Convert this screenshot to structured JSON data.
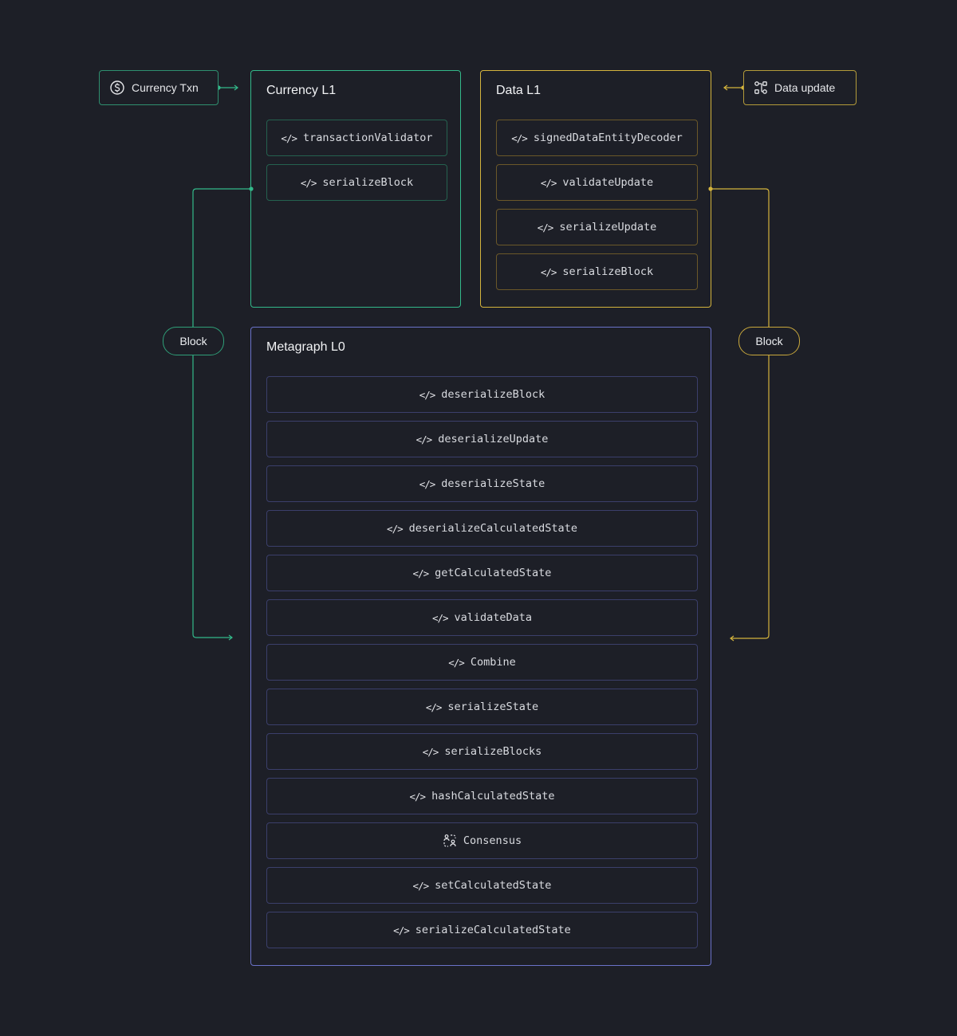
{
  "colors": {
    "background": "#1d1f27",
    "green": "#33b98a",
    "yellow": "#d4b43d",
    "blue": "#6a72c9"
  },
  "sources": {
    "currency_txn": {
      "label": "Currency Txn",
      "icon": "dollar-circle-icon"
    },
    "data_update": {
      "label": "Data update",
      "icon": "route-icon"
    }
  },
  "currency_l1": {
    "title": "Currency L1",
    "functions": [
      {
        "icon": "code-icon",
        "label": "transactionValidator"
      },
      {
        "icon": "code-icon",
        "label": "serializeBlock"
      }
    ]
  },
  "data_l1": {
    "title": "Data L1",
    "functions": [
      {
        "icon": "code-icon",
        "label": "signedDataEntityDecoder"
      },
      {
        "icon": "code-icon",
        "label": "validateUpdate"
      },
      {
        "icon": "code-icon",
        "label": "serializeUpdate"
      },
      {
        "icon": "code-icon",
        "label": "serializeBlock"
      }
    ]
  },
  "connectors": {
    "left_label": "Block",
    "right_label": "Block"
  },
  "metagraph_l0": {
    "title": "Metagraph L0",
    "functions": [
      {
        "icon": "code-icon",
        "label": "deserializeBlock"
      },
      {
        "icon": "code-icon",
        "label": "deserializeUpdate"
      },
      {
        "icon": "code-icon",
        "label": "deserializeState"
      },
      {
        "icon": "code-icon",
        "label": "deserializeCalculatedState"
      },
      {
        "icon": "code-icon",
        "label": "getCalculatedState"
      },
      {
        "icon": "code-icon",
        "label": "validateData"
      },
      {
        "icon": "code-icon",
        "label": "Combine"
      },
      {
        "icon": "code-icon",
        "label": "serializeState"
      },
      {
        "icon": "code-icon",
        "label": "serializeBlocks"
      },
      {
        "icon": "code-icon",
        "label": "hashCalculatedState"
      },
      {
        "icon": "users-consensus-icon",
        "label": "Consensus"
      },
      {
        "icon": "code-icon",
        "label": "setCalculatedState"
      },
      {
        "icon": "code-icon",
        "label": "serializeCalculatedState"
      }
    ]
  },
  "code_glyph": "</>"
}
